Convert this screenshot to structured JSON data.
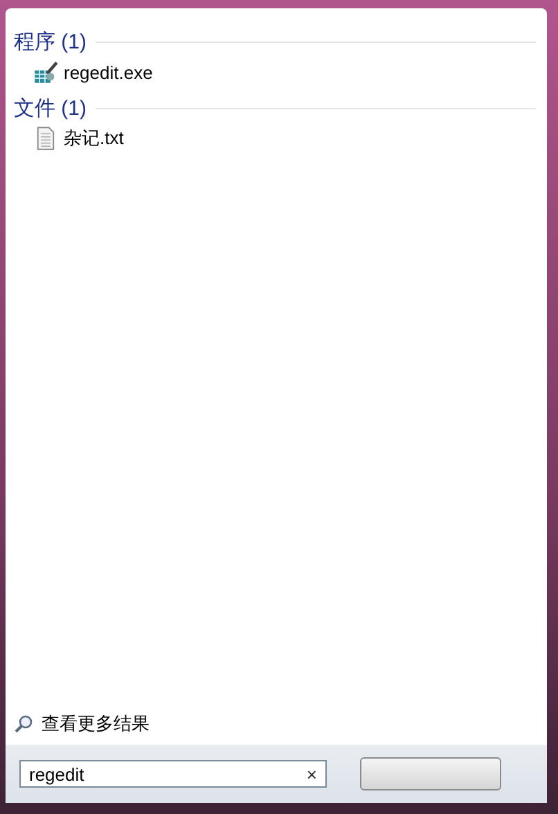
{
  "groups": [
    {
      "title": "程序 (1)",
      "items": [
        {
          "label": "regedit.exe",
          "kind": "program"
        }
      ]
    },
    {
      "title": "文件 (1)",
      "items": [
        {
          "label": "杂记.txt",
          "kind": "file"
        }
      ]
    }
  ],
  "more_results": "查看更多结果",
  "search": {
    "value": "regedit",
    "clear": "×"
  }
}
